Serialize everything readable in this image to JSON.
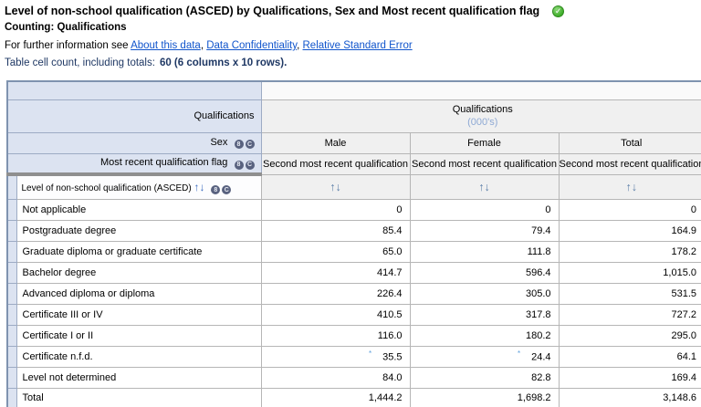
{
  "header": {
    "title": "Level of non-school qualification (ASCED) by Qualifications, Sex and Most recent qualification flag",
    "counting": "Counting: Qualifications",
    "info_prefix": "For further information see",
    "links": [
      "About this data",
      "Data Confidentiality",
      "Relative Standard Error"
    ],
    "link_sep": ",",
    "cell_count_label": "Table cell count, including totals:",
    "cell_count_value": "60 (6 columns x 10 rows)."
  },
  "icons": {
    "valid": "✓",
    "up": "↑",
    "down": "↓",
    "circle_8": "8",
    "circle_c": "C"
  },
  "table": {
    "row_dim_top": "Qualifications",
    "col_group_label": "Qualifications",
    "col_group_unit": "(000's)",
    "sex_label": "Sex",
    "flag_label": "Most recent qualification flag",
    "row_dim_label": "Level of non-school qualification (ASCED)",
    "annotation_marker": "*",
    "columns": [
      {
        "sex": "Male",
        "flag": "Second most recent qualification"
      },
      {
        "sex": "Female",
        "flag": "Second most recent qualification"
      },
      {
        "sex": "Total",
        "flag": "Second most recent qualification"
      }
    ],
    "rows": [
      {
        "label": "Not applicable",
        "values": [
          "0",
          "0",
          "0"
        ]
      },
      {
        "label": "Postgraduate degree",
        "values": [
          "85.4",
          "79.4",
          "164.9"
        ]
      },
      {
        "label": "Graduate diploma or graduate certificate",
        "values": [
          "65.0",
          "111.8",
          "178.2"
        ]
      },
      {
        "label": "Bachelor degree",
        "values": [
          "414.7",
          "596.4",
          "1,015.0"
        ]
      },
      {
        "label": "Advanced diploma or diploma",
        "values": [
          "226.4",
          "305.0",
          "531.5"
        ]
      },
      {
        "label": "Certificate III or IV",
        "values": [
          "410.5",
          "317.8",
          "727.2"
        ]
      },
      {
        "label": "Certificate I or II",
        "values": [
          "116.0",
          "180.2",
          "295.0"
        ]
      },
      {
        "label": "Certificate n.f.d.",
        "values": [
          "35.5",
          "24.4",
          "64.1"
        ]
      },
      {
        "label": "Level not determined",
        "values": [
          "84.0",
          "82.8",
          "169.4"
        ]
      },
      {
        "label": "Total",
        "values": [
          "1,444.2",
          "1,698.2",
          "3,148.6"
        ]
      }
    ]
  }
}
